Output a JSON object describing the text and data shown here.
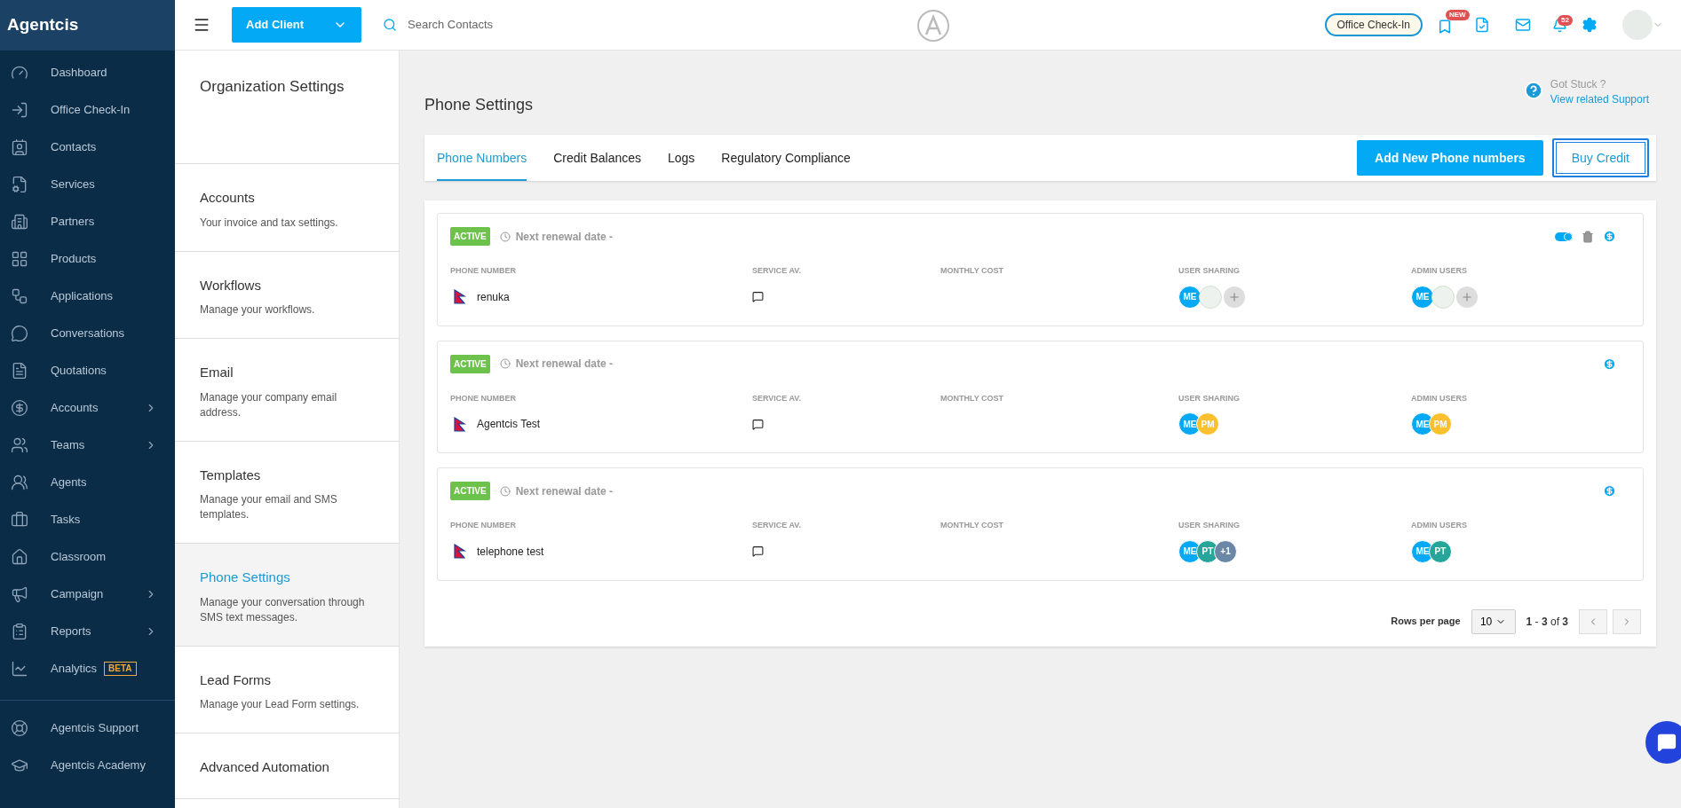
{
  "brand": "Agentcis",
  "sidebar": {
    "items": [
      {
        "label": "Dashboard",
        "has_submenu": false
      },
      {
        "label": "Office Check-In",
        "has_submenu": false
      },
      {
        "label": "Contacts",
        "has_submenu": false
      },
      {
        "label": "Services",
        "has_submenu": false
      },
      {
        "label": "Partners",
        "has_submenu": false
      },
      {
        "label": "Products",
        "has_submenu": false
      },
      {
        "label": "Applications",
        "has_submenu": false
      },
      {
        "label": "Conversations",
        "has_submenu": false
      },
      {
        "label": "Quotations",
        "has_submenu": false
      },
      {
        "label": "Accounts",
        "has_submenu": true
      },
      {
        "label": "Teams",
        "has_submenu": true
      },
      {
        "label": "Agents",
        "has_submenu": false
      },
      {
        "label": "Tasks",
        "has_submenu": false
      },
      {
        "label": "Classroom",
        "has_submenu": false
      },
      {
        "label": "Campaign",
        "has_submenu": true
      },
      {
        "label": "Reports",
        "has_submenu": true
      },
      {
        "label": "Analytics",
        "has_submenu": false,
        "badge": "BETA"
      }
    ],
    "footer_items": [
      {
        "label": "Agentcis Support"
      },
      {
        "label": "Agentcis Academy"
      }
    ]
  },
  "topbar": {
    "add_button": "Add Client",
    "search": {
      "placeholder": "Search Contacts"
    },
    "check_in_button": "Office Check-In",
    "new_badge": "NEW",
    "notification_count": "52"
  },
  "settings_nav": {
    "title": "Organization Settings",
    "items": [
      {
        "title": "Accounts",
        "description": "Your invoice and tax settings.",
        "selected": false
      },
      {
        "title": "Workflows",
        "description": "Manage your workflows.",
        "selected": false
      },
      {
        "title": "Email",
        "description": "Manage your company email address.",
        "selected": false
      },
      {
        "title": "Templates",
        "description": "Manage your email and SMS templates.",
        "selected": false
      },
      {
        "title": "Phone Settings",
        "description": "Manage your conversation through SMS text messages.",
        "selected": true
      },
      {
        "title": "Lead Forms",
        "description": "Manage your Lead Form settings.",
        "selected": false
      },
      {
        "title": "Advanced Automation",
        "selected": false
      }
    ]
  },
  "page": {
    "title": "Phone Settings",
    "help": {
      "question": "Got Stuck ?",
      "link": "View related Support"
    },
    "tabs": [
      {
        "label": "Phone Numbers",
        "selected": true
      },
      {
        "label": "Credit Balances",
        "selected": false
      },
      {
        "label": "Logs",
        "selected": false
      },
      {
        "label": "Regulatory Compliance",
        "selected": false
      }
    ],
    "buttons": [
      {
        "label": "Add New Phone numbers",
        "kind": "primary"
      },
      {
        "label": "Buy Credit",
        "kind": "outline"
      }
    ],
    "numbers": [
      {
        "status": "ACTIVE",
        "renewal": "Next renewal date -",
        "columns": [
          "PHONE NUMBER",
          "SERVICE AV.",
          "MONTHLY COST",
          "USER SHARING",
          "ADMIN USERS"
        ],
        "name": "renuka",
        "actions": [
          {
            "kind": "toggle",
            "on": true
          },
          {
            "kind": "delete"
          },
          {
            "kind": "billing"
          }
        ],
        "user_sharing": [
          {
            "kind": "initials",
            "text": "ME",
            "color": "#03a9f4"
          },
          {
            "kind": "photo"
          },
          {
            "kind": "add"
          }
        ],
        "admin_users": [
          {
            "kind": "initials",
            "text": "ME",
            "color": "#03a9f4"
          },
          {
            "kind": "photo"
          },
          {
            "kind": "add"
          }
        ]
      },
      {
        "status": "ACTIVE",
        "renewal": "Next renewal date -",
        "columns": [
          "PHONE NUMBER",
          "SERVICE AV.",
          "MONTHLY COST",
          "USER SHARING",
          "ADMIN USERS"
        ],
        "name": "Agentcis Test",
        "actions": [
          {
            "kind": "billing"
          }
        ],
        "user_sharing": [
          {
            "kind": "initials",
            "text": "ME",
            "color": "#03a9f4"
          },
          {
            "kind": "initials",
            "text": "PM",
            "color": "#fbc02d"
          }
        ],
        "admin_users": [
          {
            "kind": "initials",
            "text": "ME",
            "color": "#03a9f4"
          },
          {
            "kind": "initials",
            "text": "PM",
            "color": "#fbc02d"
          }
        ]
      },
      {
        "status": "ACTIVE",
        "renewal": "Next renewal date -",
        "columns": [
          "PHONE NUMBER",
          "SERVICE AV.",
          "MONTHLY COST",
          "USER SHARING",
          "ADMIN USERS"
        ],
        "name": "telephone test",
        "actions": [
          {
            "kind": "billing"
          }
        ],
        "user_sharing": [
          {
            "kind": "initials",
            "text": "ME",
            "color": "#03a9f4"
          },
          {
            "kind": "initials",
            "text": "PT",
            "color": "#26a69a"
          },
          {
            "kind": "initials",
            "text": "+1",
            "color": "#6b87a6"
          }
        ],
        "admin_users": [
          {
            "kind": "initials",
            "text": "ME",
            "color": "#03a9f4"
          },
          {
            "kind": "initials",
            "text": "PT",
            "color": "#26a69a"
          }
        ]
      }
    ],
    "pagination": {
      "label": "Rows per page",
      "rows": "10",
      "range": "**1** - **3** of **3**"
    }
  }
}
